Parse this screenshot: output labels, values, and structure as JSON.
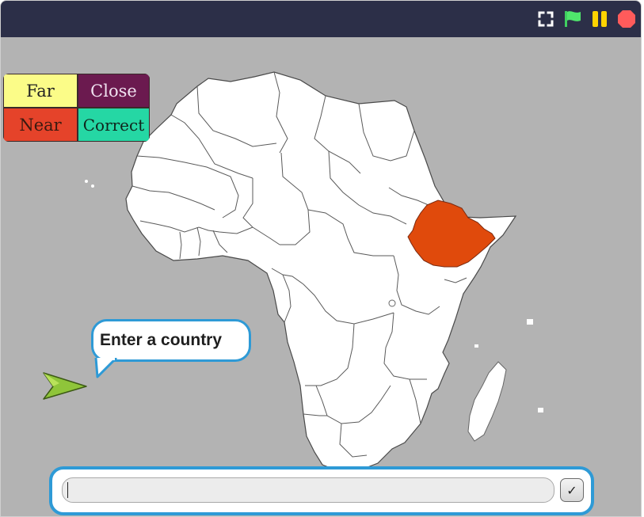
{
  "toolbar": {
    "fullscreen_icon": "fullscreen-icon",
    "green_flag_icon": "green-flag-icon",
    "pause_icon": "pause-icon",
    "stop_icon": "stop-icon"
  },
  "legend": {
    "far": "Far",
    "close": "Close",
    "near": "Near",
    "correct": "Correct",
    "colors": {
      "far": "#fbfc88",
      "close": "#6b1a4f",
      "near": "#e5432a",
      "correct": "#25d7a4"
    }
  },
  "map": {
    "highlighted_country_color": "#e04a0c",
    "land_color": "#ffffff",
    "background_color": "#b3b3b3"
  },
  "speech": {
    "text": "Enter a country"
  },
  "answer": {
    "value": "",
    "submit_symbol": "✓"
  },
  "colors": {
    "titlebar": "#2c2f48",
    "accent": "#2e9ad6",
    "flag": "#4fe66c",
    "pause": "#ffd400",
    "stop": "#ff5b5b"
  }
}
